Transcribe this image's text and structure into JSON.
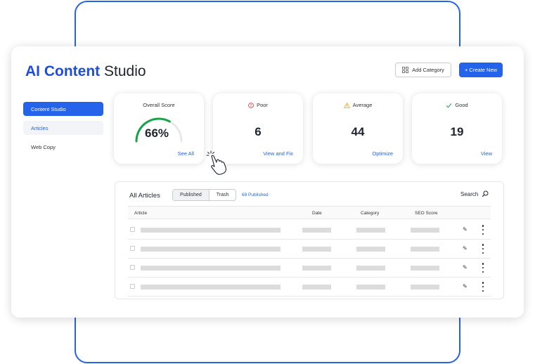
{
  "app": {
    "title_brand": "AI Content",
    "title_rest": "Studio",
    "add_category_label": "Add Category",
    "create_new_label": "+ Create New",
    "accent_color": "#2563eb"
  },
  "sidebar": {
    "items": [
      {
        "label": "Content Studio",
        "state": "active"
      },
      {
        "label": "Articles",
        "state": "hover"
      },
      {
        "label": "Web Copy",
        "state": "normal"
      }
    ]
  },
  "cards": {
    "overall": {
      "title": "Overall Score",
      "value": "66%",
      "score_fraction": 0.66,
      "link": "See All"
    },
    "poor": {
      "title": "Poor",
      "value": "6",
      "link": "View and Fix",
      "icon": "info-circle-icon",
      "color": "#dc2626"
    },
    "average": {
      "title": "Average",
      "value": "44",
      "link": "Optimize",
      "icon": "warning-triangle-icon",
      "color": "#f59e0b"
    },
    "good": {
      "title": "Good",
      "value": "19",
      "link": "View",
      "icon": "check-icon",
      "color": "#16a34a"
    }
  },
  "articles": {
    "title": "All Articles",
    "tabs": [
      "Published",
      "Trash"
    ],
    "active_tab": "Published",
    "published_count": "69 Published",
    "search_label": "Search",
    "columns": [
      "Article",
      "Date",
      "Category",
      "SEO Score"
    ],
    "rows": 4
  }
}
